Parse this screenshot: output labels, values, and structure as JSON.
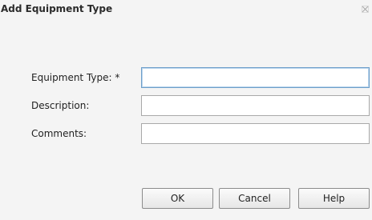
{
  "dialog": {
    "title": "Add Equipment Type"
  },
  "form": {
    "equipment_type": {
      "label": "Equipment Type: *",
      "value": ""
    },
    "description": {
      "label": "Description:",
      "value": ""
    },
    "comments": {
      "label": "Comments:",
      "value": ""
    }
  },
  "buttons": {
    "ok_label": "OK",
    "cancel_label": "Cancel",
    "help_label": "Help"
  },
  "icons": {
    "close": "close-icon"
  }
}
